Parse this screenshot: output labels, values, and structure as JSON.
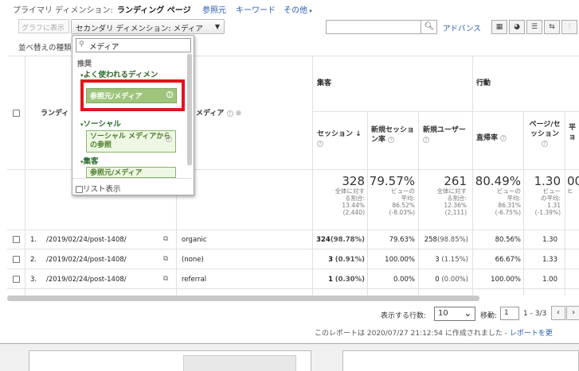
{
  "topbar": {
    "label": "プライマリ ディメンション:",
    "current": "ランディング ページ",
    "links": [
      "参照元",
      "キーワード",
      "その他"
    ]
  },
  "controls": {
    "graph_button": "グラフに表示",
    "secondary_dimension": "セカンダリ ディメンション: メディア",
    "sort_label": "並べ替えの種類",
    "advanced": "アドバンス"
  },
  "dropdown": {
    "search_value": "メディア",
    "section_recommended": "推奨",
    "group_frequent": "よく使われるディメン",
    "item_ref_medium": "参照元/メディア",
    "group_social": "ソーシャル",
    "item_social": "ソーシャル メディアからの参照",
    "group_acquisition": "集客",
    "item_acq": "参照元/メディア",
    "list_display": "リスト表示"
  },
  "table": {
    "group_acquisition": "集客",
    "group_behavior": "行動",
    "col_landing": "ランディ",
    "col_medium": "メディア",
    "col_sessions": "セッション",
    "col_new_session_rate": "新規セッション率",
    "col_new_users": "新規ユーザー",
    "col_bounce": "直帰率",
    "col_pages": "ページ/セッション",
    "col_avg": "平ョ",
    "totals": {
      "sessions": {
        "big": "328",
        "s1": "全体に対す",
        "s2": "る割合:",
        "s3": "13.44%",
        "s4": "(2,440)"
      },
      "new_rate": {
        "big": "79.57%",
        "s1": "ビューの",
        "s2": "平均:",
        "s3": "86.52%",
        "s4": "(-8.03%)"
      },
      "new_users": {
        "big": "261",
        "s1": "全体に対す",
        "s2": "る割合:",
        "s3": "12.36%",
        "s4": "(2,111)"
      },
      "bounce": {
        "big": "80.49%",
        "s1": "ビューの",
        "s2": "平均:",
        "s3": "86.31%",
        "s4": "(-6.75%)"
      },
      "pages": {
        "big": "1.30",
        "s1": "ビュー",
        "s2": "の平均:",
        "s3": "1.31",
        "s4": "(-1.39%)"
      },
      "avg": {
        "big": "00",
        "s1": "ヒ"
      }
    },
    "rows": [
      {
        "idx": "1.",
        "page": "/2019/02/24/post-1408/",
        "medium": "organic",
        "sessions": "324",
        "sessions_pct": "(98.78%)",
        "new_rate": "79.63%",
        "new_users": "258",
        "new_users_pct": "(98.85%)",
        "bounce": "80.56%",
        "pages": "1.30"
      },
      {
        "idx": "2.",
        "page": "/2019/02/24/post-1408/",
        "medium": "(none)",
        "sessions": "3",
        "sessions_pct": "(0.91%)",
        "new_rate": "100.00%",
        "new_users": "3",
        "new_users_pct": "(1.15%)",
        "bounce": "66.67%",
        "pages": "1.33"
      },
      {
        "idx": "3.",
        "page": "/2019/02/24/post-1408/",
        "medium": "referral",
        "sessions": "1",
        "sessions_pct": "(0.30%)",
        "new_rate": "0.00%",
        "new_users": "0",
        "new_users_pct": "(0.00%)",
        "bounce": "100.00%",
        "pages": "1.00"
      }
    ]
  },
  "footer": {
    "rows_label": "表示する行数:",
    "rows_value": "10",
    "goto_label": "移動:",
    "goto_value": "1",
    "range": "1 - 3/3",
    "created_text": "このレポートは 2020/07/27 21:12:54 に作成されました - ",
    "refresh_link": "レポートを更"
  }
}
